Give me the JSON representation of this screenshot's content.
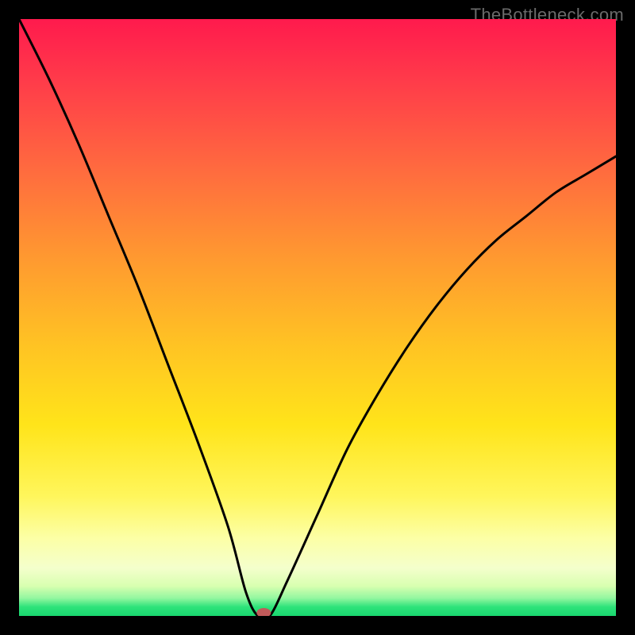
{
  "watermark": "TheBottleneck.com",
  "chart_data": {
    "type": "line",
    "title": "",
    "xlabel": "",
    "ylabel": "",
    "xlim": [
      0,
      100
    ],
    "ylim": [
      0,
      100
    ],
    "x": [
      0,
      5,
      10,
      15,
      20,
      25,
      30,
      35,
      38,
      40,
      42,
      45,
      50,
      55,
      60,
      65,
      70,
      75,
      80,
      85,
      90,
      95,
      100
    ],
    "values": [
      100,
      90,
      79,
      67,
      55,
      42,
      29,
      15,
      4,
      0,
      0,
      6,
      17,
      28,
      37,
      45,
      52,
      58,
      63,
      67,
      71,
      74,
      77
    ],
    "marker": {
      "x": 41,
      "y": 0
    },
    "gradient_stops": [
      {
        "pos": 0,
        "color": "#ff1a4d"
      },
      {
        "pos": 50,
        "color": "#ffd21f"
      },
      {
        "pos": 100,
        "color": "#19d66f"
      }
    ]
  }
}
